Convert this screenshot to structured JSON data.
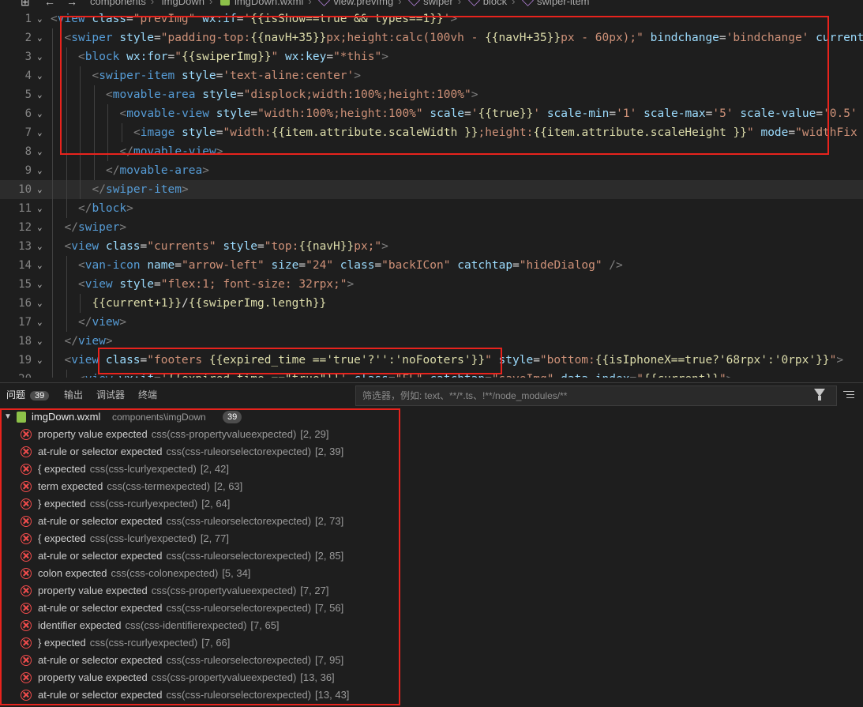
{
  "breadcrumb": {
    "items": [
      "components",
      "imgDown",
      "imgDown.wxml",
      "view.prevImg",
      "swiper",
      "block",
      "swiper-item"
    ]
  },
  "editor": {
    "lines": [
      {
        "n": "1",
        "indent": 0,
        "segs": [
          [
            "t",
            "<"
          ],
          [
            "tag",
            "view"
          ],
          [
            "plain",
            " "
          ],
          [
            "attr",
            "class"
          ],
          [
            "plain",
            "="
          ],
          [
            "str",
            "\"prevImg\""
          ],
          [
            "plain",
            " "
          ],
          [
            "attr",
            "wx:if"
          ],
          [
            "plain",
            "="
          ],
          [
            "str",
            "'"
          ],
          [
            "expr",
            "{{isShow==true && types==1}}"
          ],
          [
            "str",
            "'"
          ],
          [
            "t",
            ">"
          ]
        ]
      },
      {
        "n": "2",
        "indent": 1,
        "segs": [
          [
            "t",
            "<"
          ],
          [
            "tag",
            "swiper"
          ],
          [
            "plain",
            " "
          ],
          [
            "attr",
            "style"
          ],
          [
            "plain",
            "="
          ],
          [
            "str",
            "\"padding-top:"
          ],
          [
            "expr",
            "{{navH+35}}"
          ],
          [
            "str",
            "px;height:calc(100vh - "
          ],
          [
            "expr",
            "{{navH+35}}"
          ],
          [
            "str",
            "px - 60px);\""
          ],
          [
            "plain",
            " "
          ],
          [
            "attr",
            "bindchange"
          ],
          [
            "plain",
            "="
          ],
          [
            "str",
            "'bindchange'"
          ],
          [
            "plain",
            " "
          ],
          [
            "attr",
            "current"
          ]
        ]
      },
      {
        "n": "3",
        "indent": 2,
        "segs": [
          [
            "t",
            "<"
          ],
          [
            "tag",
            "block"
          ],
          [
            "plain",
            " "
          ],
          [
            "attr",
            "wx:for"
          ],
          [
            "plain",
            "="
          ],
          [
            "str",
            "\""
          ],
          [
            "expr",
            "{{swiperImg}}"
          ],
          [
            "str",
            "\""
          ],
          [
            "plain",
            " "
          ],
          [
            "attr",
            "wx:key"
          ],
          [
            "plain",
            "="
          ],
          [
            "str",
            "\"*this\""
          ],
          [
            "t",
            ">"
          ]
        ]
      },
      {
        "n": "4",
        "indent": 3,
        "segs": [
          [
            "t",
            "<"
          ],
          [
            "tag",
            "swiper-item"
          ],
          [
            "plain",
            " "
          ],
          [
            "attr",
            "style"
          ],
          [
            "plain",
            "="
          ],
          [
            "str",
            "'text-aline:center'"
          ],
          [
            "t",
            ">"
          ]
        ]
      },
      {
        "n": "5",
        "indent": 4,
        "segs": [
          [
            "t",
            "<"
          ],
          [
            "tag",
            "movable-area"
          ],
          [
            "plain",
            " "
          ],
          [
            "attr",
            "style"
          ],
          [
            "plain",
            "="
          ],
          [
            "str",
            "\"displock;width:100%;height:100%\""
          ],
          [
            "t",
            ">"
          ]
        ]
      },
      {
        "n": "6",
        "indent": 5,
        "segs": [
          [
            "t",
            "<"
          ],
          [
            "tag",
            "movable-view"
          ],
          [
            "plain",
            " "
          ],
          [
            "attr",
            "style"
          ],
          [
            "plain",
            "="
          ],
          [
            "str",
            "\"width:100%;height:100%\""
          ],
          [
            "plain",
            " "
          ],
          [
            "attr",
            "scale"
          ],
          [
            "plain",
            "="
          ],
          [
            "str",
            "'"
          ],
          [
            "expr",
            "{{true}}"
          ],
          [
            "str",
            "'"
          ],
          [
            "plain",
            " "
          ],
          [
            "attr",
            "scale-min"
          ],
          [
            "plain",
            "="
          ],
          [
            "str",
            "'1'"
          ],
          [
            "plain",
            " "
          ],
          [
            "attr",
            "scale-max"
          ],
          [
            "plain",
            "="
          ],
          [
            "str",
            "'5'"
          ],
          [
            "plain",
            " "
          ],
          [
            "attr",
            "scale-value"
          ],
          [
            "plain",
            "="
          ],
          [
            "str",
            "'0.5'"
          ]
        ]
      },
      {
        "n": "7",
        "indent": 6,
        "segs": [
          [
            "t",
            "<"
          ],
          [
            "tag",
            "image"
          ],
          [
            "plain",
            " "
          ],
          [
            "attr",
            "style"
          ],
          [
            "plain",
            "="
          ],
          [
            "str",
            "\"width:"
          ],
          [
            "expr",
            "{{item.attribute.scaleWidth }}"
          ],
          [
            "str",
            ";height:"
          ],
          [
            "expr",
            "{{item.attribute.scaleHeight }}"
          ],
          [
            "str",
            "\""
          ],
          [
            "plain",
            " "
          ],
          [
            "attr",
            "mode"
          ],
          [
            "plain",
            "="
          ],
          [
            "str",
            "\"widthFix"
          ]
        ]
      },
      {
        "n": "8",
        "indent": 5,
        "segs": [
          [
            "t",
            "</"
          ],
          [
            "tag",
            "movable-view"
          ],
          [
            "t",
            ">"
          ]
        ]
      },
      {
        "n": "9",
        "indent": 4,
        "segs": [
          [
            "t",
            "</"
          ],
          [
            "tag",
            "movable-area"
          ],
          [
            "t",
            ">"
          ]
        ]
      },
      {
        "n": "10",
        "indent": 3,
        "segs": [
          [
            "t",
            "</"
          ],
          [
            "tag",
            "swiper-item"
          ],
          [
            "t",
            ">"
          ]
        ]
      },
      {
        "n": "11",
        "indent": 2,
        "segs": [
          [
            "t",
            "</"
          ],
          [
            "tag",
            "block"
          ],
          [
            "t",
            ">"
          ]
        ]
      },
      {
        "n": "12",
        "indent": 1,
        "segs": [
          [
            "t",
            "</"
          ],
          [
            "tag",
            "swiper"
          ],
          [
            "t",
            ">"
          ]
        ]
      },
      {
        "n": "13",
        "indent": 1,
        "segs": [
          [
            "t",
            "<"
          ],
          [
            "tag",
            "view"
          ],
          [
            "plain",
            " "
          ],
          [
            "attr",
            "class"
          ],
          [
            "plain",
            "="
          ],
          [
            "str",
            "\"currents\""
          ],
          [
            "plain",
            " "
          ],
          [
            "attr",
            "style"
          ],
          [
            "plain",
            "="
          ],
          [
            "str",
            "\"top:"
          ],
          [
            "expr",
            "{{navH}}"
          ],
          [
            "str",
            "px;\""
          ],
          [
            "t",
            ">"
          ]
        ]
      },
      {
        "n": "14",
        "indent": 2,
        "segs": [
          [
            "t",
            "<"
          ],
          [
            "tag",
            "van-icon"
          ],
          [
            "plain",
            " "
          ],
          [
            "attr",
            "name"
          ],
          [
            "plain",
            "="
          ],
          [
            "str",
            "\"arrow-left\""
          ],
          [
            "plain",
            " "
          ],
          [
            "attr",
            "size"
          ],
          [
            "plain",
            "="
          ],
          [
            "str",
            "\"24\""
          ],
          [
            "plain",
            " "
          ],
          [
            "attr",
            "class"
          ],
          [
            "plain",
            "="
          ],
          [
            "str",
            "\"backICon\""
          ],
          [
            "plain",
            " "
          ],
          [
            "attr",
            "catchtap"
          ],
          [
            "plain",
            "="
          ],
          [
            "str",
            "\"hideDialog\""
          ],
          [
            "plain",
            " "
          ],
          [
            "t",
            "/>"
          ]
        ]
      },
      {
        "n": "15",
        "indent": 2,
        "segs": [
          [
            "t",
            "<"
          ],
          [
            "tag",
            "view"
          ],
          [
            "plain",
            " "
          ],
          [
            "attr",
            "style"
          ],
          [
            "plain",
            "="
          ],
          [
            "str",
            "\"flex:1; font-size: 32rpx;\""
          ],
          [
            "t",
            ">"
          ]
        ]
      },
      {
        "n": "16",
        "indent": 3,
        "segs": [
          [
            "expr",
            "{{current+1}}"
          ],
          [
            "plain",
            "/"
          ],
          [
            "expr",
            "{{swiperImg.length}}"
          ]
        ]
      },
      {
        "n": "17",
        "indent": 2,
        "segs": [
          [
            "t",
            "</"
          ],
          [
            "tag",
            "view"
          ],
          [
            "t",
            ">"
          ]
        ]
      },
      {
        "n": "18",
        "indent": 1,
        "segs": [
          [
            "t",
            "</"
          ],
          [
            "tag",
            "view"
          ],
          [
            "t",
            ">"
          ]
        ]
      },
      {
        "n": "19",
        "indent": 1,
        "segs": [
          [
            "t",
            "<"
          ],
          [
            "tag",
            "view"
          ],
          [
            "plain",
            " "
          ],
          [
            "attr",
            "class"
          ],
          [
            "plain",
            "="
          ],
          [
            "str",
            "\"footers "
          ],
          [
            "expr",
            "{{expired_time =='true'?'':'noFooters'}}"
          ],
          [
            "str",
            "\""
          ],
          [
            "plain",
            " "
          ],
          [
            "attr",
            "style"
          ],
          [
            "plain",
            "="
          ],
          [
            "str",
            "\"bottom:"
          ],
          [
            "expr",
            "{{isIphoneX==true?'68rpx':'0rpx'}}"
          ],
          [
            "str",
            "\""
          ],
          [
            "t",
            ">"
          ]
        ]
      },
      {
        "n": "20",
        "indent": 2,
        "segs": [
          [
            "t",
            "<"
          ],
          [
            "tag",
            "view"
          ],
          [
            "plain",
            " "
          ],
          [
            "attr",
            "wx:if"
          ],
          [
            "plain",
            "="
          ],
          [
            "str",
            "'"
          ],
          [
            "expr",
            "{{expired_time ==\"true\"}}"
          ],
          [
            "str",
            "'"
          ],
          [
            "plain",
            " "
          ],
          [
            "attr",
            "class"
          ],
          [
            "plain",
            "="
          ],
          [
            "str",
            "\"FL\""
          ],
          [
            "plain",
            " "
          ],
          [
            "attr",
            "catchtap"
          ],
          [
            "plain",
            "="
          ],
          [
            "str",
            "\"saveImg\""
          ],
          [
            "plain",
            " "
          ],
          [
            "attr",
            "data-index"
          ],
          [
            "plain",
            "="
          ],
          [
            "str",
            "\""
          ],
          [
            "expr",
            "{{current}}"
          ],
          [
            "str",
            "\""
          ],
          [
            "t",
            ">"
          ]
        ]
      }
    ]
  },
  "panel": {
    "tabs": [
      {
        "label": "问题",
        "badge": "39"
      },
      {
        "label": "输出"
      },
      {
        "label": "调试器"
      },
      {
        "label": "终端"
      }
    ],
    "filter_placeholder": "筛选器，例如: text、**/*.ts、!**/node_modules/**",
    "file": {
      "name": "imgDown.wxml",
      "path": "components\\imgDown",
      "count": "39"
    },
    "problems": [
      {
        "msg": "property value expected",
        "src": "css(css-propertyvalueexpected)",
        "pos": "[2, 29]"
      },
      {
        "msg": "at-rule or selector expected",
        "src": "css(css-ruleorselectorexpected)",
        "pos": "[2, 39]"
      },
      {
        "msg": "{ expected",
        "src": "css(css-lcurlyexpected)",
        "pos": "[2, 42]"
      },
      {
        "msg": "term expected",
        "src": "css(css-termexpected)",
        "pos": "[2, 63]"
      },
      {
        "msg": "} expected",
        "src": "css(css-rcurlyexpected)",
        "pos": "[2, 64]"
      },
      {
        "msg": "at-rule or selector expected",
        "src": "css(css-ruleorselectorexpected)",
        "pos": "[2, 73]"
      },
      {
        "msg": "{ expected",
        "src": "css(css-lcurlyexpected)",
        "pos": "[2, 77]"
      },
      {
        "msg": "at-rule or selector expected",
        "src": "css(css-ruleorselectorexpected)",
        "pos": "[2, 85]"
      },
      {
        "msg": "colon expected",
        "src": "css(css-colonexpected)",
        "pos": "[5, 34]"
      },
      {
        "msg": "property value expected",
        "src": "css(css-propertyvalueexpected)",
        "pos": "[7, 27]"
      },
      {
        "msg": "at-rule or selector expected",
        "src": "css(css-ruleorselectorexpected)",
        "pos": "[7, 56]"
      },
      {
        "msg": "identifier expected",
        "src": "css(css-identifierexpected)",
        "pos": "[7, 65]"
      },
      {
        "msg": "} expected",
        "src": "css(css-rcurlyexpected)",
        "pos": "[7, 66]"
      },
      {
        "msg": "at-rule or selector expected",
        "src": "css(css-ruleorselectorexpected)",
        "pos": "[7, 95]"
      },
      {
        "msg": "property value expected",
        "src": "css(css-propertyvalueexpected)",
        "pos": "[13, 36]"
      },
      {
        "msg": "at-rule or selector expected",
        "src": "css(css-ruleorselectorexpected)",
        "pos": "[13, 43]"
      }
    ]
  },
  "colors": {
    "error": "#f14c4c",
    "highlight_box": "#e8231d",
    "tag": "#569cd6",
    "attr": "#9cdcfe",
    "string": "#ce9178",
    "expr": "#dcdcaa"
  }
}
